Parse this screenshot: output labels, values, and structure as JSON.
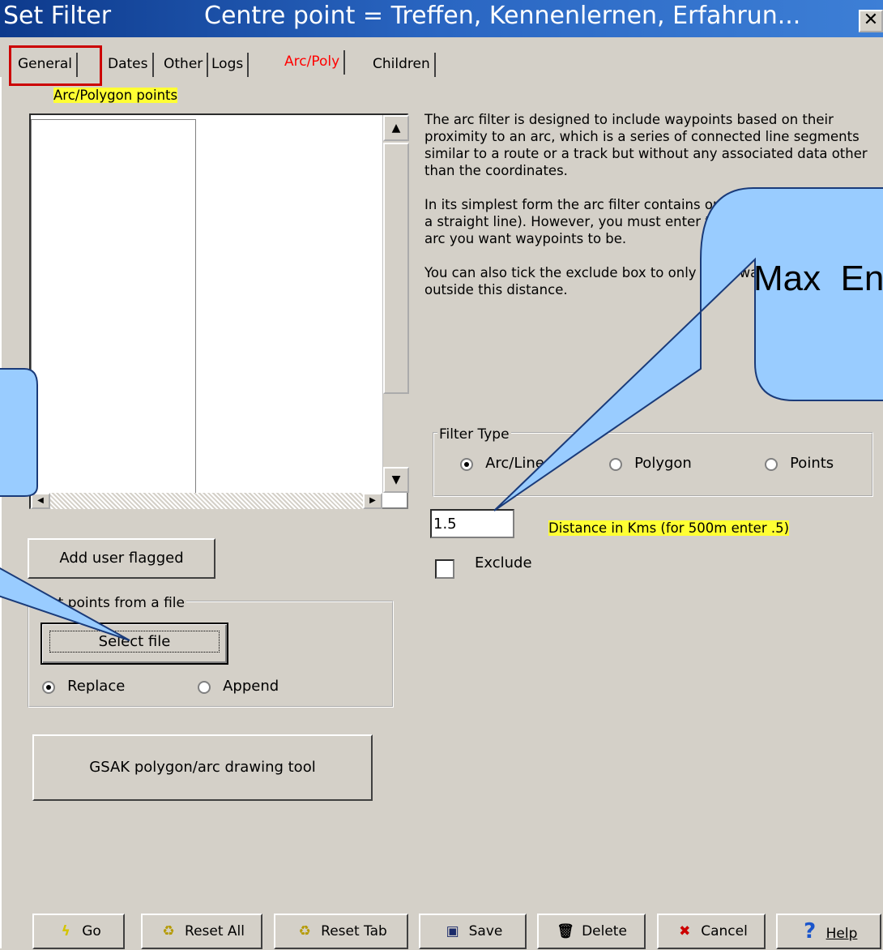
{
  "window": {
    "title": "Set Filter",
    "subtitle": "Centre point = Treffen, Kennenlernen, Erfahrun...",
    "close_label": "✕"
  },
  "tabs": [
    {
      "label": "General",
      "active": false
    },
    {
      "label": "Dates",
      "active": false
    },
    {
      "label": "Other",
      "active": false
    },
    {
      "label": "Logs",
      "active": false
    },
    {
      "label": "Arc/Poly",
      "active": true
    },
    {
      "label": "Children",
      "active": false
    }
  ],
  "arc": {
    "points_label": "Arc/Polygon points",
    "add_user_flagged": "Add user flagged",
    "file_group_label": "Get points from a file",
    "select_file": "Select file",
    "replace_label": "Replace",
    "append_label": "Append",
    "drawing_tool": "GSAK polygon/arc drawing tool"
  },
  "description": {
    "p1": "The arc filter is designed to include waypoints based on their proximity to an arc, which is a series of connected line segments similar to a route or a track but without any associated data other than the coordinates.",
    "p2": "In its simplest form the arc filter contains only two points (that is, a straight line). However, you must enter the distance from the arc you want waypoints to be.",
    "p3": "You can also tick the exclude box to only show waypoints that are outside this distance."
  },
  "filter_type": {
    "label": "Filter Type",
    "options": [
      "Arc/Line",
      "Polygon",
      "Points"
    ],
    "selected": "Arc/Line"
  },
  "distance": {
    "value": "1.5",
    "label": "Distance in Kms (for 500m enter .5)"
  },
  "exclude": {
    "label": "Exclude",
    "checked": false
  },
  "callouts": {
    "right_text": "Max  En"
  },
  "bottom_buttons": [
    {
      "label": "Go",
      "icon": "lightning-icon"
    },
    {
      "label": "Reset All",
      "icon": "reset-icon"
    },
    {
      "label": "Reset Tab",
      "icon": "reset-icon"
    },
    {
      "label": "Save",
      "icon": "floppy-icon"
    },
    {
      "label": "Delete",
      "icon": "trash-icon"
    },
    {
      "label": "Cancel",
      "icon": "x-icon"
    },
    {
      "label": "Help",
      "icon": "question-icon"
    }
  ],
  "colors": {
    "titlebar": "#1e55ad",
    "active_tab": "#ff0000",
    "highlight": "#ffff33",
    "callout_fill": "#99ccff",
    "annotation_box": "#cc0000"
  }
}
